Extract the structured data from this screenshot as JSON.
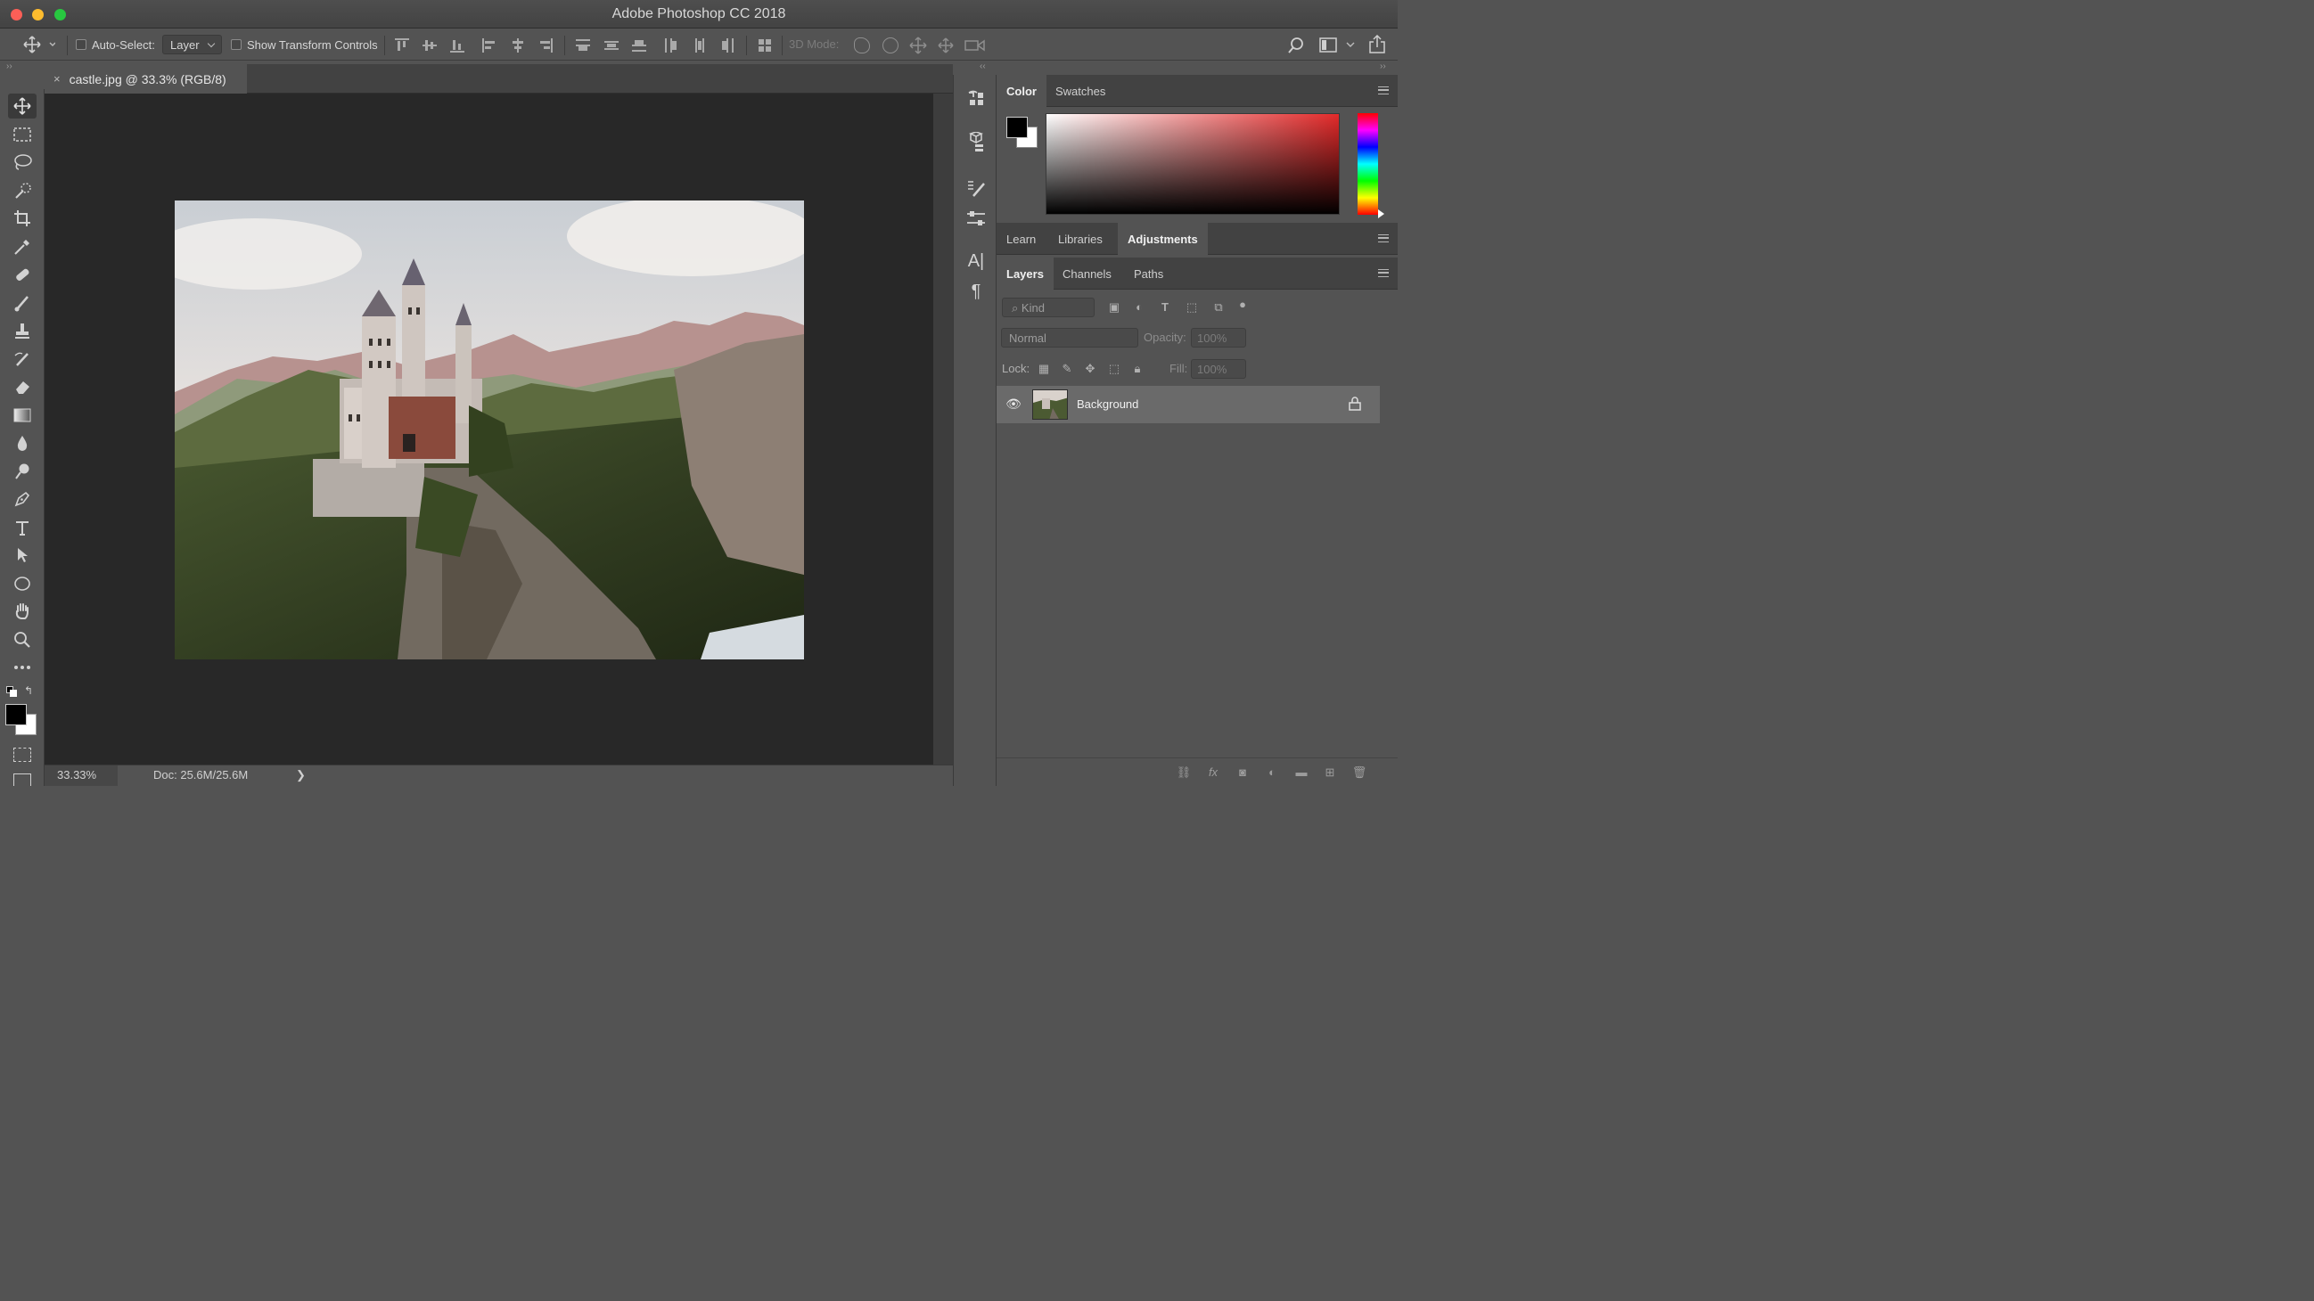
{
  "window": {
    "title": "Adobe Photoshop CC 2018"
  },
  "options_bar": {
    "auto_select_label": "Auto-Select:",
    "auto_select_value": "Layer",
    "show_transform_label": "Show Transform Controls",
    "mode_3d_label": "3D Mode:"
  },
  "document": {
    "tab_title": "castle.jpg @ 33.3% (RGB/8)",
    "close_glyph": "×"
  },
  "status_bar": {
    "zoom": "33.33%",
    "doc_info": "Doc: 25.6M/25.6M",
    "arrow": "❯"
  },
  "color_panel": {
    "tabs": [
      "Color",
      "Swatches"
    ],
    "foreground": "#000000",
    "background": "#ffffff",
    "hue_color": "#e32a2a"
  },
  "learn_panel": {
    "tabs": [
      "Learn",
      "Libraries",
      "Adjustments"
    ]
  },
  "layers_panel": {
    "tabs": [
      "Layers",
      "Channels",
      "Paths"
    ],
    "filter_placeholder": "Kind",
    "blend_mode": "Normal",
    "opacity_label": "Opacity:",
    "opacity_value": "100%",
    "lock_label": "Lock:",
    "fill_label": "Fill:",
    "fill_value": "100%",
    "layers": [
      {
        "name": "Background",
        "visible": true,
        "locked": true
      }
    ]
  },
  "tools": [
    "move-icon",
    "rectangular-marquee-icon",
    "lasso-icon",
    "quick-selection-icon",
    "crop-icon",
    "eyedropper-icon",
    "healing-brush-icon",
    "brush-icon",
    "clone-stamp-icon",
    "history-brush-icon",
    "eraser-icon",
    "gradient-icon",
    "blur-icon",
    "dodge-icon",
    "pen-icon",
    "type-icon",
    "path-selection-icon",
    "ellipse-icon",
    "hand-icon",
    "zoom-icon",
    "more-tools-icon"
  ]
}
